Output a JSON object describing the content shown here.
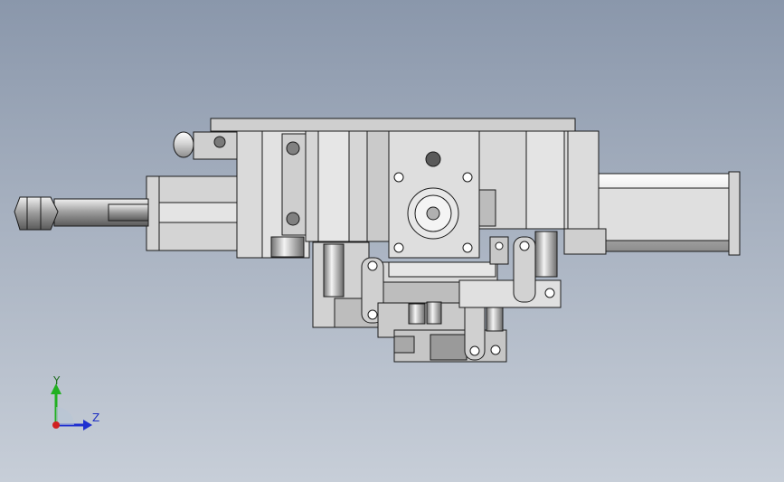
{
  "viewport": {
    "background_top": "#8a97ab",
    "background_bottom": "#c7ced8"
  },
  "model": {
    "part_color": "#d9d9d9",
    "edge_color": "#1a1a1a"
  },
  "triad": {
    "y_label": "Y",
    "z_label": "Z",
    "y_color": "#22b022",
    "z_color": "#1f2fd0",
    "x_color": "#d02020"
  }
}
